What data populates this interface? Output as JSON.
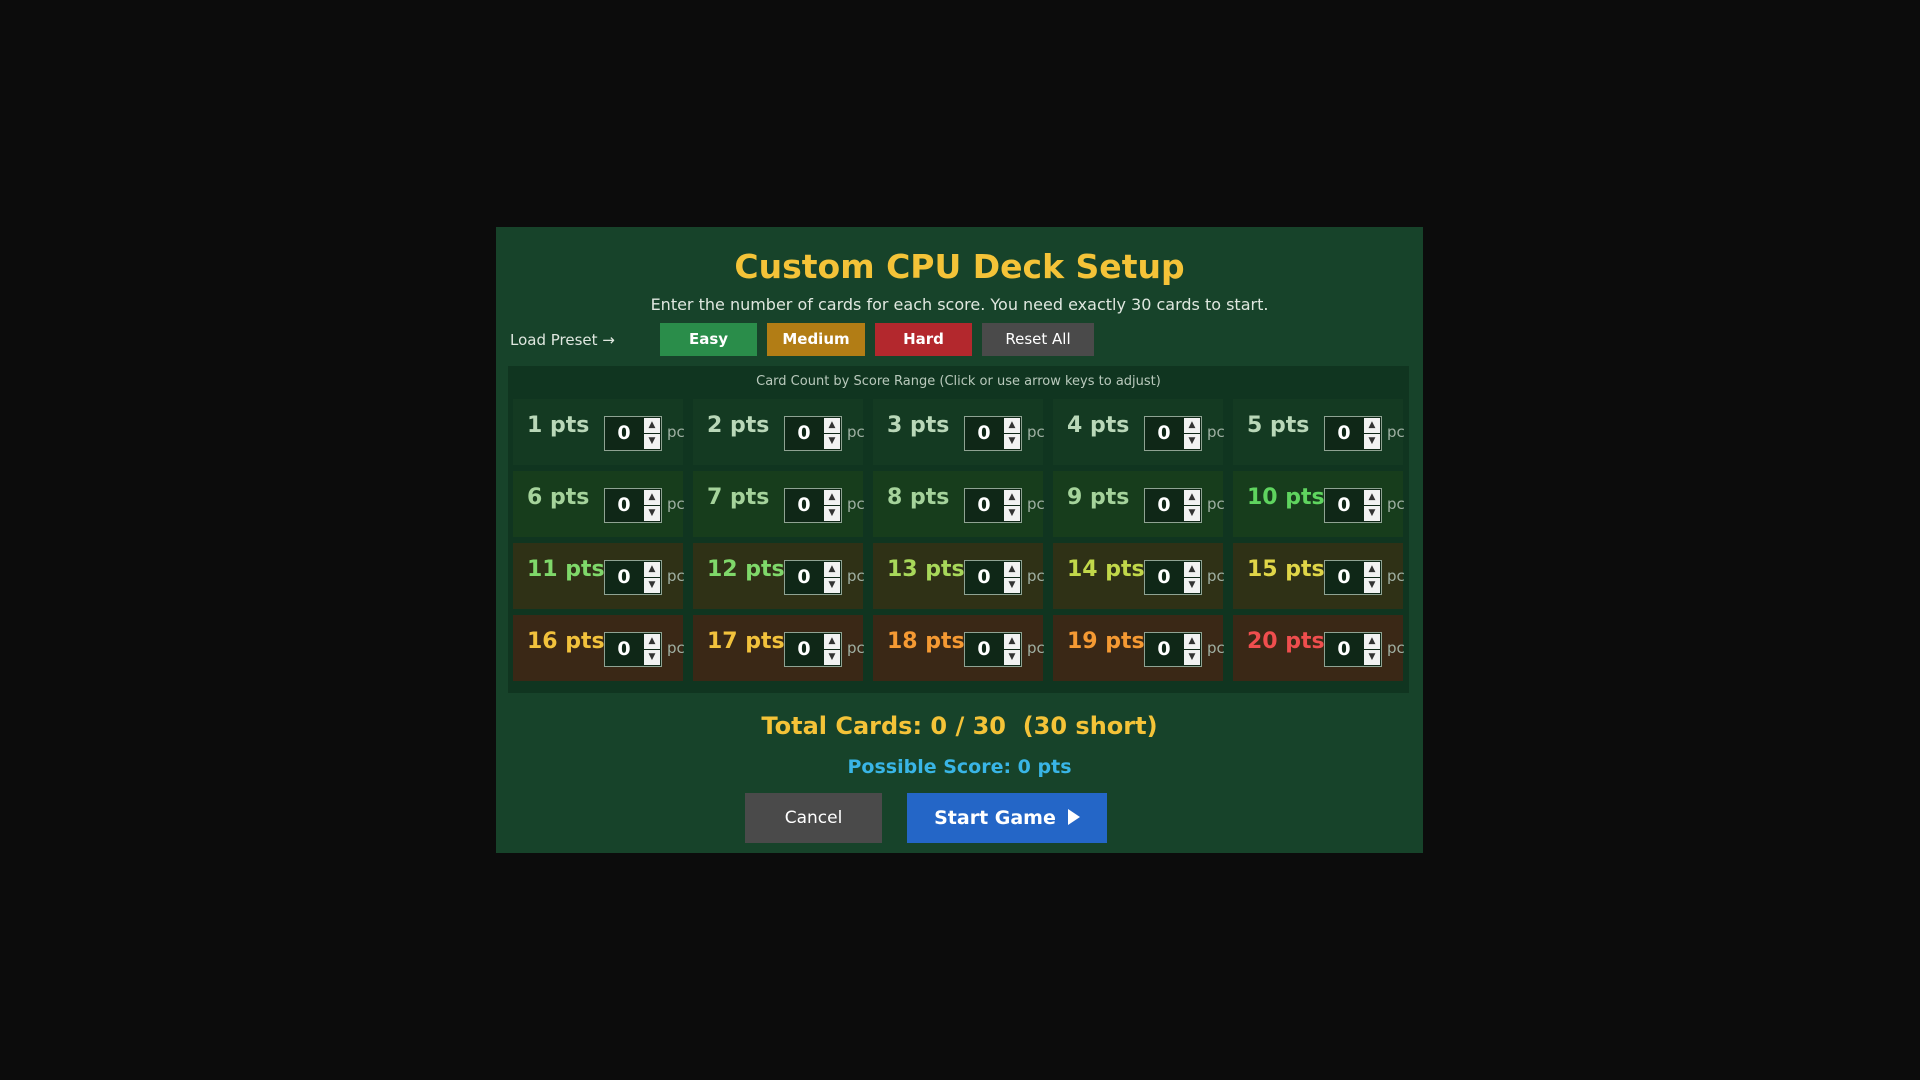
{
  "dialog": {
    "title": "Custom CPU Deck Setup",
    "subtitle": "Enter the number of cards for each score. You need exactly 30 cards to start.",
    "preset_label": "Load Preset →",
    "presets": {
      "easy": "Easy",
      "medium": "Medium",
      "hard": "Hard",
      "reset": "Reset All"
    },
    "panel_caption": "Card Count by Score Range  (Click or use arrow keys to adjust)",
    "unit": "pc",
    "cells": [
      {
        "label": "1 pts",
        "value": "0",
        "color": "#b9d7b8"
      },
      {
        "label": "2 pts",
        "value": "0",
        "color": "#b9d7b8"
      },
      {
        "label": "3 pts",
        "value": "0",
        "color": "#b9d7b8"
      },
      {
        "label": "4 pts",
        "value": "0",
        "color": "#b9d7b8"
      },
      {
        "label": "5 pts",
        "value": "0",
        "color": "#b9d7b8"
      },
      {
        "label": "6 pts",
        "value": "0",
        "color": "#a5d39b"
      },
      {
        "label": "7 pts",
        "value": "0",
        "color": "#a5d39b"
      },
      {
        "label": "8 pts",
        "value": "0",
        "color": "#a5d39b"
      },
      {
        "label": "9 pts",
        "value": "0",
        "color": "#a5d39b"
      },
      {
        "label": "10 pts",
        "value": "0",
        "color": "#5fd45f"
      },
      {
        "label": "11 pts",
        "value": "0",
        "color": "#7fd86a"
      },
      {
        "label": "12 pts",
        "value": "0",
        "color": "#7fd86a"
      },
      {
        "label": "13 pts",
        "value": "0",
        "color": "#a8d85a"
      },
      {
        "label": "14 pts",
        "value": "0",
        "color": "#c2d84a"
      },
      {
        "label": "15 pts",
        "value": "0",
        "color": "#e0d648"
      },
      {
        "label": "16 pts",
        "value": "0",
        "color": "#f2c23c"
      },
      {
        "label": "17 pts",
        "value": "0",
        "color": "#f2c23c"
      },
      {
        "label": "18 pts",
        "value": "0",
        "color": "#f59a33"
      },
      {
        "label": "19 pts",
        "value": "0",
        "color": "#f59a33"
      },
      {
        "label": "20 pts",
        "value": "0",
        "color": "#ef4e4e"
      }
    ],
    "total_text": "Total Cards: 0 / 30  (30 short)",
    "possible_text": "Possible Score: 0 pts",
    "cancel_label": "Cancel",
    "start_label": "Start Game"
  }
}
